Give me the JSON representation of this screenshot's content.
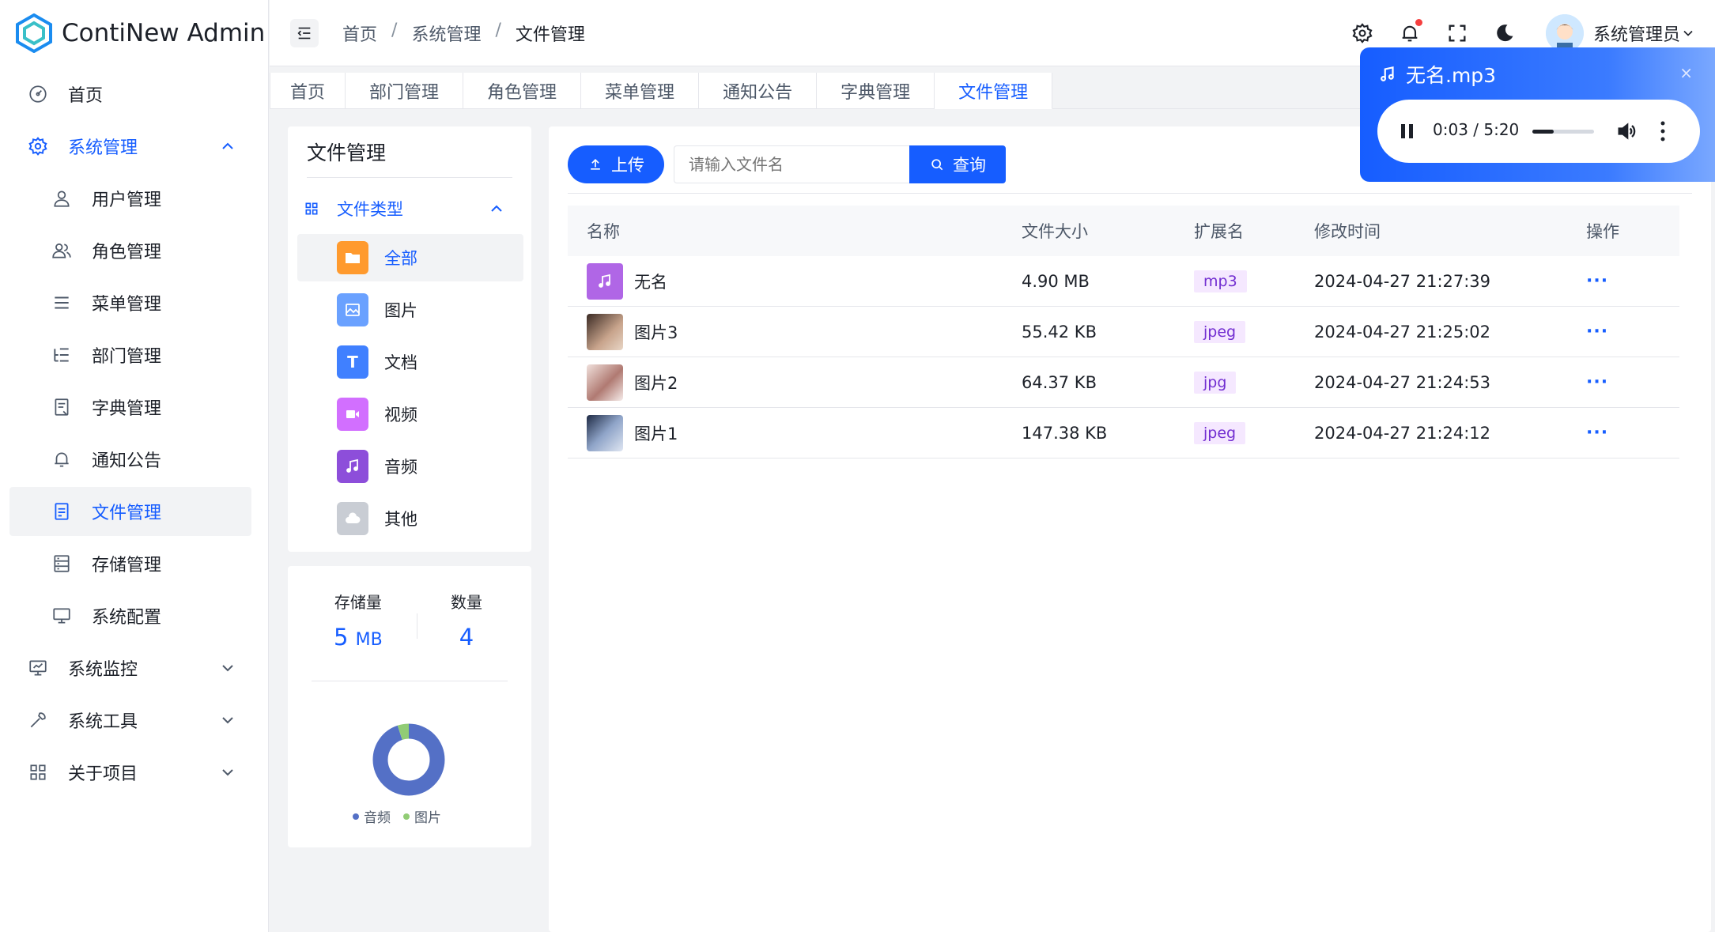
{
  "app": {
    "title": "ContiNew Admin"
  },
  "sidebar": {
    "items": [
      {
        "label": "首页",
        "icon": "dashboard-icon"
      },
      {
        "label": "系统管理",
        "icon": "gear-icon"
      },
      {
        "label": "用户管理",
        "icon": "user-icon"
      },
      {
        "label": "角色管理",
        "icon": "user-group-icon"
      },
      {
        "label": "菜单管理",
        "icon": "menu-icon"
      },
      {
        "label": "部门管理",
        "icon": "list-icon"
      },
      {
        "label": "字典管理",
        "icon": "book-icon"
      },
      {
        "label": "通知公告",
        "icon": "bell-icon"
      },
      {
        "label": "文件管理",
        "icon": "file-icon"
      },
      {
        "label": "存储管理",
        "icon": "storage-icon"
      },
      {
        "label": "系统配置",
        "icon": "desktop-icon"
      },
      {
        "label": "系统监控",
        "icon": "monitor-icon"
      },
      {
        "label": "系统工具",
        "icon": "wrench-icon"
      },
      {
        "label": "关于项目",
        "icon": "apps-icon"
      }
    ]
  },
  "header": {
    "breadcrumb": [
      "首页",
      "系统管理",
      "文件管理"
    ],
    "separator": "/",
    "user_name": "系统管理员"
  },
  "tabs": [
    "首页",
    "部门管理",
    "角色管理",
    "菜单管理",
    "通知公告",
    "字典管理",
    "文件管理"
  ],
  "type_panel": {
    "title": "文件管理",
    "group_label": "文件类型",
    "types": [
      {
        "label": "全部",
        "color": "#ff9a2e"
      },
      {
        "label": "图片",
        "color": "#6aa1ff"
      },
      {
        "label": "文档",
        "color": "#4080ff",
        "letter": "T"
      },
      {
        "label": "视频",
        "color": "#d26fff"
      },
      {
        "label": "音频",
        "color": "#8d4eda"
      },
      {
        "label": "其他",
        "color": "#c9cdd4"
      }
    ]
  },
  "stats": {
    "storage_label": "存储量",
    "storage_value": "5",
    "storage_unit": "MB",
    "count_label": "数量",
    "count_value": "4",
    "chart_data": {
      "type": "pie",
      "categories": [
        "音频",
        "图片"
      ],
      "values": [
        4.9,
        0.27
      ],
      "colors": [
        "#5470c6",
        "#91cc75"
      ]
    }
  },
  "toolbar": {
    "upload_label": "上传",
    "search_placeholder": "请输入文件名",
    "search_label": "查询"
  },
  "table": {
    "columns": [
      "名称",
      "文件大小",
      "扩展名",
      "修改时间",
      "操作"
    ],
    "rows": [
      {
        "name": "无名",
        "size": "4.90 MB",
        "ext": "mp3",
        "time": "2024-04-27 21:27:39",
        "op": "···"
      },
      {
        "name": "图片3",
        "size": "55.42 KB",
        "ext": "jpeg",
        "time": "2024-04-27 21:25:02",
        "op": "···"
      },
      {
        "name": "图片2",
        "size": "64.37 KB",
        "ext": "jpg",
        "time": "2024-04-27 21:24:53",
        "op": "···"
      },
      {
        "name": "图片1",
        "size": "147.38 KB",
        "ext": "jpeg",
        "time": "2024-04-27 21:24:12",
        "op": "···"
      }
    ]
  },
  "audio": {
    "title": "无名.mp3",
    "close": "×",
    "current": "0:03",
    "duration": "5:20",
    "time_text": "0:03 / 5:20",
    "progress": 0.35
  }
}
